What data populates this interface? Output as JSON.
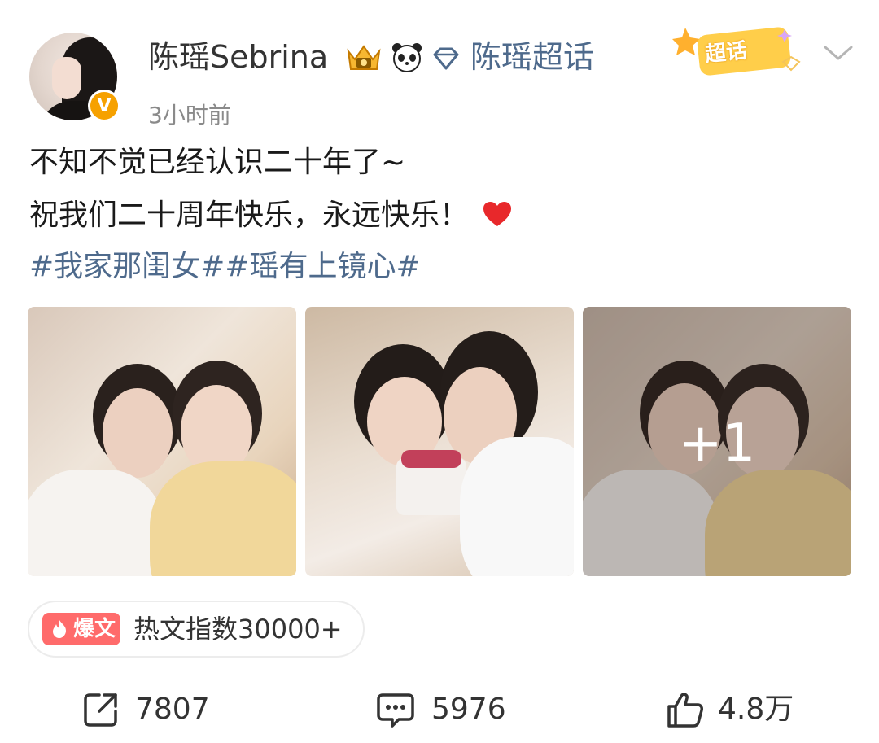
{
  "post": {
    "author": {
      "name": "陈瑶Sebrina",
      "verified_badge": "V",
      "avatar_icon": "avatar",
      "badges": [
        "crown-icon",
        "panda-icon",
        "diamond-icon"
      ]
    },
    "supertopic_link": "陈瑶超话",
    "chaohua_badge": "超话",
    "timestamp": "3小时前",
    "text_lines": [
      "不知不觉已经认识二十年了~",
      "祝我们二十周年快乐，永远快乐！"
    ],
    "hashtags": "#我家那闺女##瑶有上镜心#",
    "photos": {
      "extra_count": "+1"
    },
    "hot": {
      "tag": "爆文",
      "text": "热文指数30000+"
    },
    "actions": {
      "share": "7807",
      "comment": "5976",
      "like": "4.8万"
    }
  },
  "colors": {
    "link": "#4e6a8c",
    "hot_tag": "#ff6b6b",
    "verified": "#f6a100",
    "heart": "#e8282b"
  }
}
